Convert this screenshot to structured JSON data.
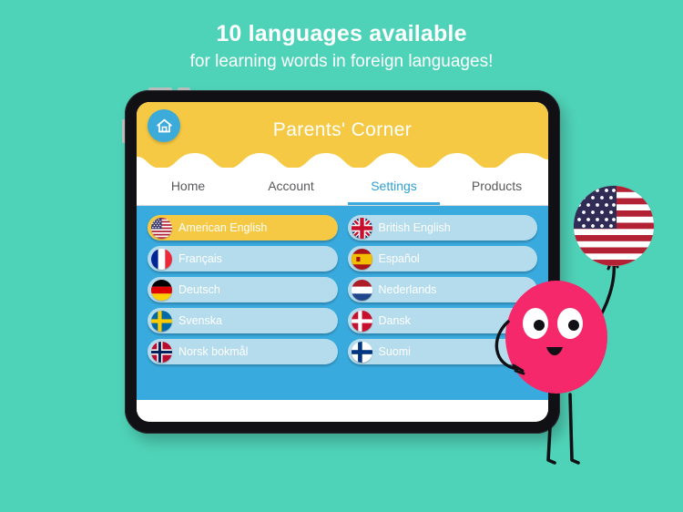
{
  "promo": {
    "title": "10 languages available",
    "subtitle": "for learning words in foreign languages!"
  },
  "colors": {
    "background": "#4fd3b8",
    "header_yellow": "#f6c944",
    "panel_blue": "#39aade",
    "button_blue": "#b5dced",
    "accent_blue": "#3aa9dd",
    "mascot_pink": "#f5286b",
    "device_black": "#111014"
  },
  "app": {
    "title": "Parents' Corner",
    "home_icon": "home-icon",
    "tabs": [
      {
        "label": "Home",
        "active": false
      },
      {
        "label": "Account",
        "active": false
      },
      {
        "label": "Settings",
        "active": true
      },
      {
        "label": "Products",
        "active": false
      }
    ],
    "languages": [
      {
        "label": "American English",
        "flag": "flag-us",
        "selected": true
      },
      {
        "label": "British English",
        "flag": "flag-gb",
        "selected": false
      },
      {
        "label": "Français",
        "flag": "flag-fr",
        "selected": false
      },
      {
        "label": "Español",
        "flag": "flag-es",
        "selected": false
      },
      {
        "label": "Deutsch",
        "flag": "flag-de",
        "selected": false
      },
      {
        "label": "Nederlands",
        "flag": "flag-nl",
        "selected": false
      },
      {
        "label": "Svenska",
        "flag": "flag-se",
        "selected": false
      },
      {
        "label": "Dansk",
        "flag": "flag-dk",
        "selected": false
      },
      {
        "label": "Norsk bokmål",
        "flag": "flag-no",
        "selected": false
      },
      {
        "label": "Suomi",
        "flag": "flag-fi",
        "selected": false
      }
    ]
  },
  "mascot": {
    "name": "pink-blob-character",
    "balloon_flag": "flag-us"
  }
}
